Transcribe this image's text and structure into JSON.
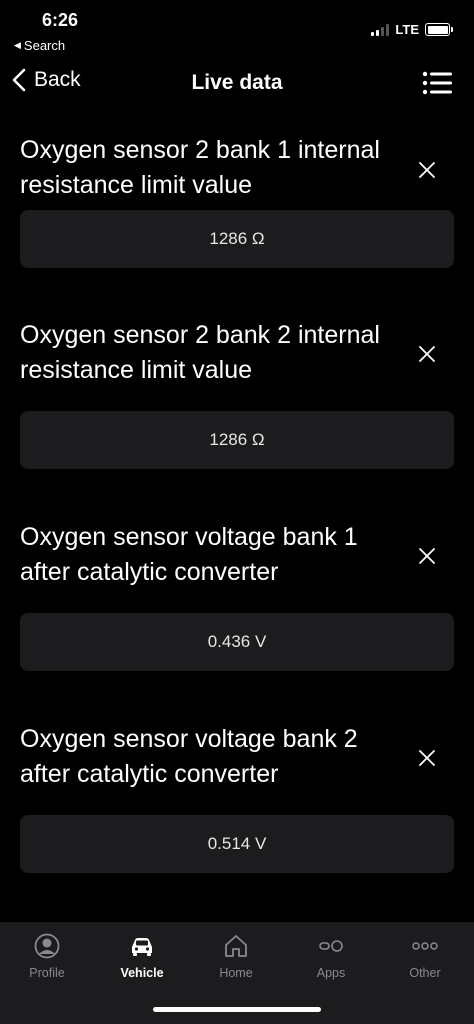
{
  "status_bar": {
    "time": "6:26",
    "back_app": "Search",
    "network": "LTE"
  },
  "nav": {
    "back_label": "Back",
    "title": "Live data"
  },
  "sensors": [
    {
      "title": "Oxygen sensor 2 bank 1 internal resistance limit value",
      "value": "1286 Ω"
    },
    {
      "title": "Oxygen sensor 2 bank 2 internal resistance limit value",
      "value": "1286 Ω"
    },
    {
      "title": "Oxygen sensor voltage bank 1 after catalytic converter",
      "value": "0.436 V"
    },
    {
      "title": "Oxygen sensor voltage bank 2 after catalytic converter",
      "value": "0.514 V"
    }
  ],
  "tabs": [
    {
      "label": "Profile",
      "icon": "profile-icon",
      "active": false
    },
    {
      "label": "Vehicle",
      "icon": "car-icon",
      "active": true
    },
    {
      "label": "Home",
      "icon": "home-icon",
      "active": false
    },
    {
      "label": "Apps",
      "icon": "apps-icon",
      "active": false
    },
    {
      "label": "Other",
      "icon": "more-dots-icon",
      "active": false
    }
  ],
  "colors": {
    "background": "#000000",
    "card": "#1c1c1e",
    "tab_inactive": "#8a8a8e",
    "tab_active": "#ffffff"
  }
}
